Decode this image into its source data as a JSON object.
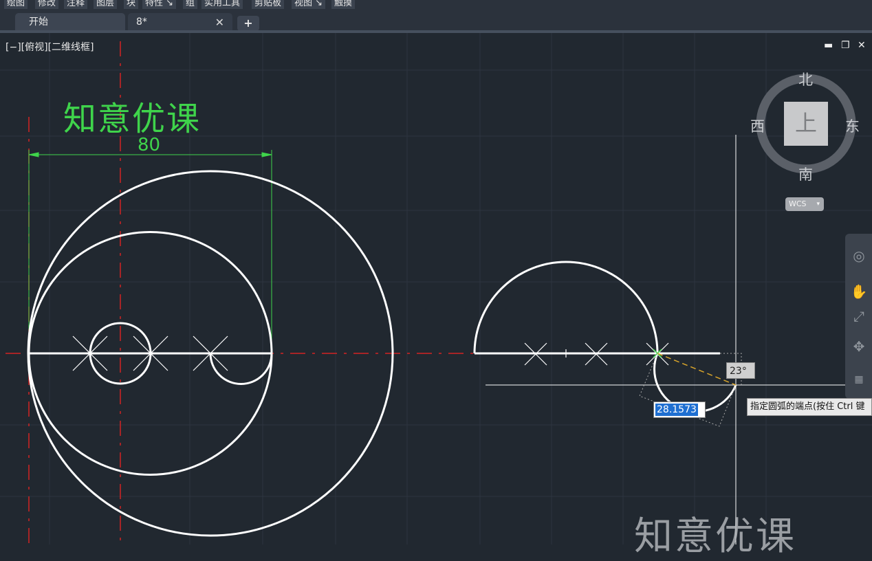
{
  "ribbon": {
    "panels": [
      {
        "label": "绘图"
      },
      {
        "label": "修改"
      },
      {
        "label": "注释"
      },
      {
        "label": "图层"
      },
      {
        "label": "块"
      },
      {
        "label": "特性 ↘"
      },
      {
        "label": "组"
      },
      {
        "label": "实用工具"
      },
      {
        "label": "剪贴板"
      },
      {
        "label": "视图 ↘"
      },
      {
        "label": "触摸"
      }
    ]
  },
  "tabs": [
    {
      "label": "开始"
    },
    {
      "label": "8*"
    }
  ],
  "tab_close_icon": "✕",
  "new_tab_icon": "+",
  "viewport": {
    "label": "[−][俯视][二维线框]",
    "controls": {
      "minimize": "▬",
      "restore": "❐",
      "close": "✕"
    }
  },
  "drawing": {
    "watermark_top": "知意优课",
    "dimension_text": "80",
    "watermark_bottom": "知意优课",
    "colors": {
      "background": "#212830",
      "geometry": "#ffffff",
      "centerline": "#d42323",
      "dimension": "#3fd44b",
      "grid": "#2d3540"
    }
  },
  "viewcube": {
    "north": "北",
    "south": "南",
    "east": "东",
    "west": "西",
    "face": "上",
    "wcs": "WCS",
    "wcs_caret": "▾"
  },
  "navbar": {
    "icons": [
      "steering-wheel-icon",
      "pan-hand-icon",
      "zoom-extents-icon",
      "orbit-icon",
      "showmotion-icon"
    ]
  },
  "command": {
    "angle": "23°",
    "length_value": "28.1573",
    "tooltip": "指定圆弧的端点(按住 Ctrl 键"
  }
}
